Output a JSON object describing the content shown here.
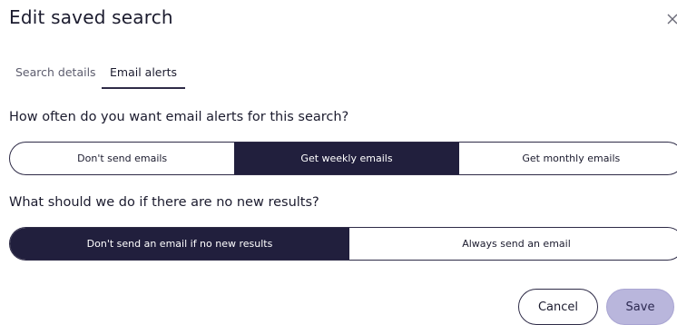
{
  "dialog": {
    "title": "Edit saved search"
  },
  "tabs": [
    {
      "label": "Search details",
      "active": false
    },
    {
      "label": "Email alerts",
      "active": true
    }
  ],
  "frequency": {
    "question": "How often do you want email alerts for this search?",
    "options": [
      {
        "label": "Don't send emails",
        "selected": false
      },
      {
        "label": "Get weekly emails",
        "selected": true
      },
      {
        "label": "Get monthly emails",
        "selected": false
      }
    ]
  },
  "no_results": {
    "question": "What should we do if there are no new results?",
    "options": [
      {
        "label": "Don't send an email if no new results",
        "selected": true
      },
      {
        "label": "Always send an email",
        "selected": false
      }
    ]
  },
  "footer": {
    "cancel_label": "Cancel",
    "save_label": "Save"
  },
  "icons": {
    "close": "close-icon"
  },
  "colors": {
    "selected_bg": "#211f3d",
    "save_bg": "#b9b6dc",
    "text": "#1b1b2e"
  }
}
